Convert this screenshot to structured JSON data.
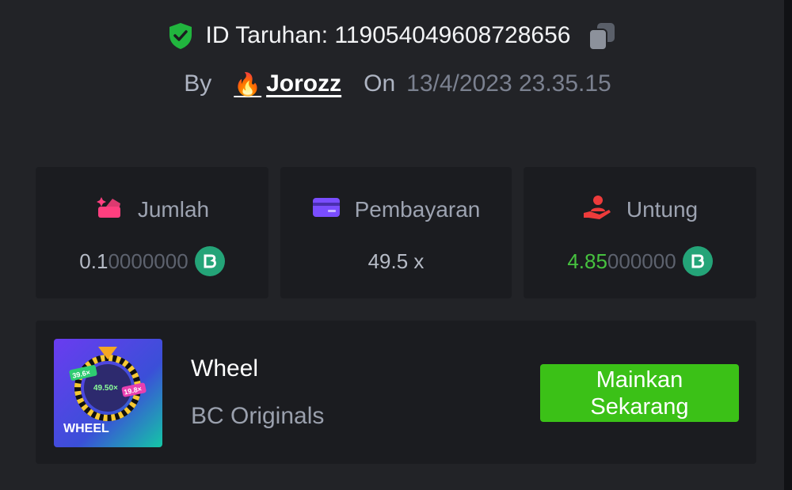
{
  "header": {
    "bet_id_label": "ID Taruhan: 119054049608728656",
    "by_label": "By",
    "user_name": "Jorozz",
    "on_label": "On",
    "date_time": "13/4/2023 23.35.15"
  },
  "stats": {
    "amount": {
      "label": "Jumlah",
      "value_main": "0.1",
      "value_dim": "0000000",
      "icon": "bet-amount-icon"
    },
    "payout": {
      "label": "Pembayaran",
      "value": "49.5 x",
      "icon": "card-icon"
    },
    "profit": {
      "label": "Untung",
      "value_main": "4.85",
      "value_dim": "000000",
      "icon": "hand-user-icon"
    },
    "currency_icon": "bc-coin-icon"
  },
  "game": {
    "name": "Wheel",
    "provider": "BC Originals",
    "play_label": "Mainkan\nSekarang",
    "thumb": {
      "title": "WHEEL",
      "multiplier_center": "49.50×",
      "multiplier_left": "39.6×",
      "multiplier_right": "19.8×"
    }
  },
  "colors": {
    "accent_green": "#3bc117",
    "profit_green": "#46c23f",
    "coin_green": "#24a478",
    "shield_green": "#21b53e",
    "card_purple": "#7a4dff",
    "amount_pink": "#ff3f7f",
    "profit_red": "#ee3b3b"
  }
}
